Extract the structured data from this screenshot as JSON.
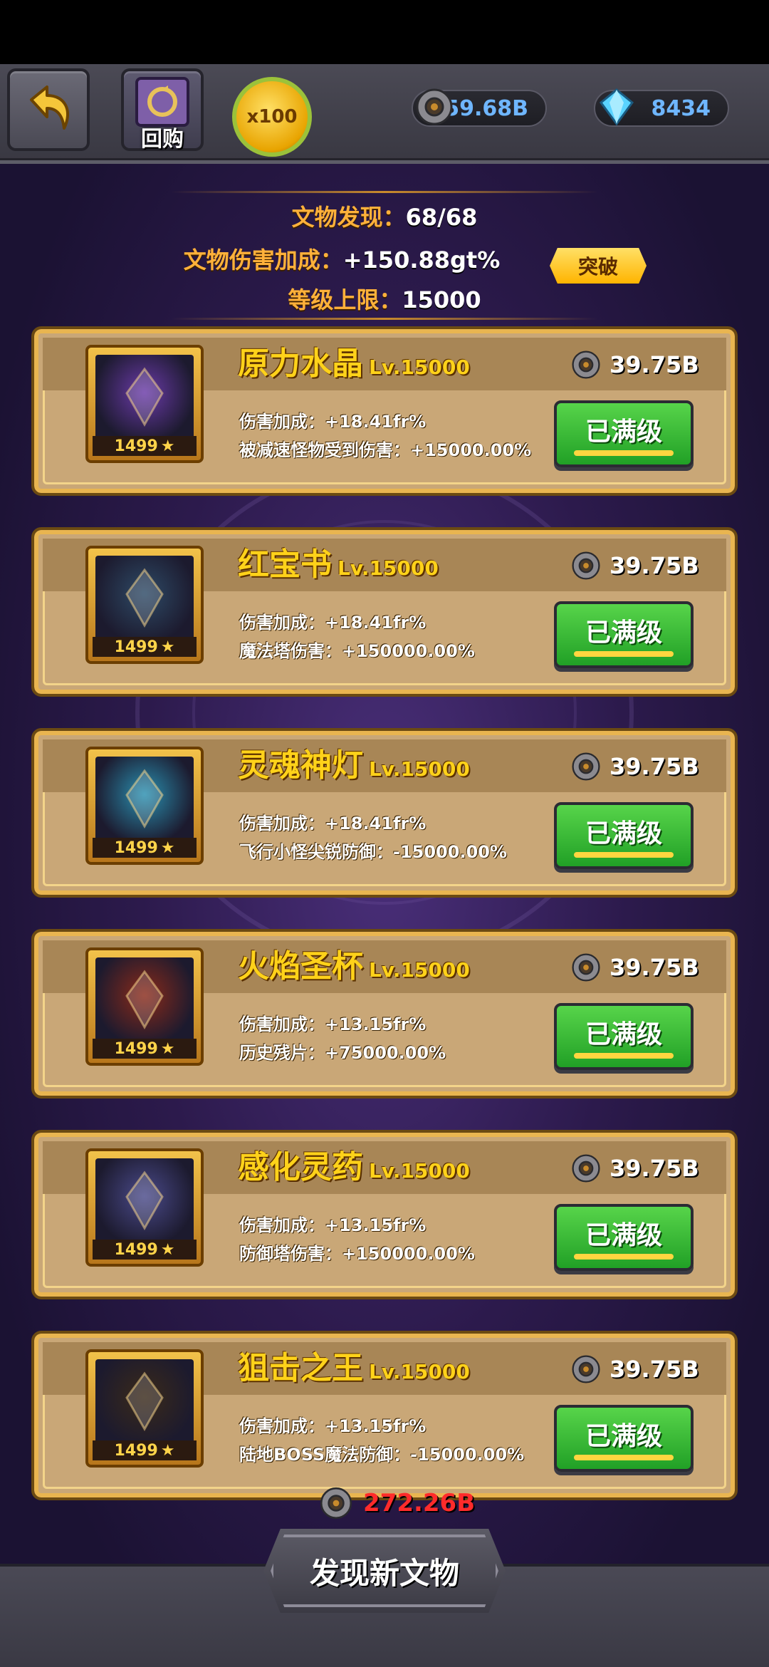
{
  "topbar": {
    "back_icon": "undo-arrow-icon",
    "buyback_label": "回购",
    "buyback_icon": "recycle-book-icon",
    "medal_label": "x100",
    "gear_amount": "59.68B",
    "gem_amount": "8434"
  },
  "info": {
    "discovered_label": "文物发现：",
    "discovered_value": "68/68",
    "damage_bonus_label": "文物伤害加成：",
    "damage_bonus_value": "+150.88gt%",
    "breakthrough_label": "突破",
    "level_cap_label": "等级上限：",
    "level_cap_value": "15000"
  },
  "items": [
    {
      "name": "原力水晶",
      "level": "Lv.15000",
      "badge": "1499",
      "cost": "39.75B",
      "stat1": "伤害加成：+18.41fr%",
      "stat2": "被减速怪物受到伤害：+15000.00%",
      "button": "已满级",
      "icon": "purple-crystal-icon",
      "glow": "#6a3aa8"
    },
    {
      "name": "红宝书",
      "level": "Lv.15000",
      "badge": "1499",
      "cost": "39.75B",
      "stat1": "伤害加成：+18.41fr%",
      "stat2": "魔法塔伤害：+150000.00%",
      "button": "已满级",
      "icon": "ruby-book-icon",
      "glow": "#2e4a66"
    },
    {
      "name": "灵魂神灯",
      "level": "Lv.15000",
      "badge": "1499",
      "cost": "39.75B",
      "stat1": "伤害加成：+18.41fr%",
      "stat2": "飞行小怪尖锐防御：-15000.00%",
      "button": "已满级",
      "icon": "soul-lamp-icon",
      "glow": "#2a8fb0"
    },
    {
      "name": "火焰圣杯",
      "level": "Lv.15000",
      "badge": "1499",
      "cost": "39.75B",
      "stat1": "伤害加成：+13.15fr%",
      "stat2": "历史残片：+75000.00%",
      "button": "已满级",
      "icon": "flame-chalice-icon",
      "glow": "#8a2a1a"
    },
    {
      "name": "感化灵药",
      "level": "Lv.15000",
      "badge": "1499",
      "cost": "39.75B",
      "stat1": "伤害加成：+13.15fr%",
      "stat2": "防御塔伤害：+150000.00%",
      "button": "已满级",
      "icon": "elixir-bottle-icon",
      "glow": "#4a4a8a"
    },
    {
      "name": "狙击之王",
      "level": "Lv.15000",
      "badge": "1499",
      "cost": "39.75B",
      "stat1": "伤害加成：+13.15fr%",
      "stat2": "陆地BOSS魔法防御：-15000.00%",
      "button": "已满级",
      "icon": "slingshot-icon",
      "glow": "#3a2a1a"
    }
  ],
  "footer": {
    "total_cost": "272.26B",
    "discover_label": "发现新文物"
  }
}
